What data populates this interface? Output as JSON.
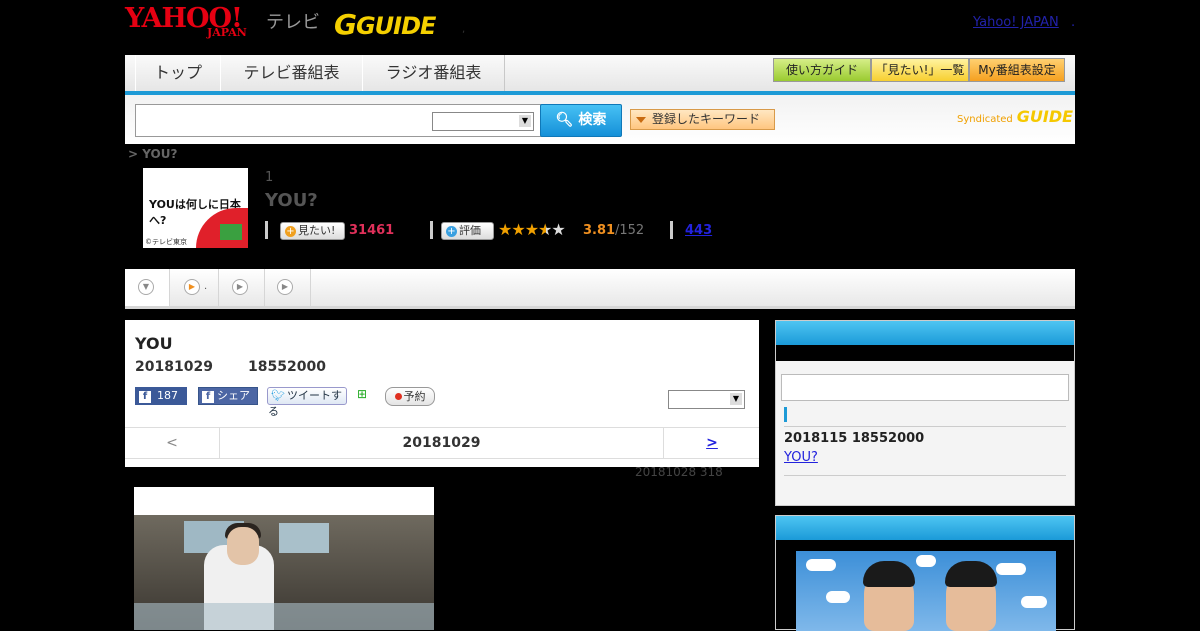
{
  "header": {
    "logo_yahoo": "YAHOO!",
    "logo_japan": "JAPAN",
    "logo_tv": "テレビ",
    "logo_gguide": "GUIDE",
    "dot": ",",
    "yahoo_japan_link": "Yahoo! JAPAN",
    "link_dot": "."
  },
  "nav": {
    "tabs": [
      "トップ",
      "テレビ番組表",
      "ラジオ番組表"
    ],
    "buttons": [
      "使い方ガイド",
      "「見たい!」一覧",
      "My番組表設定"
    ]
  },
  "search": {
    "input_value": "",
    "select_value": "",
    "search_label": "検索",
    "keyword_label": "登録したキーワード",
    "syndicated": "Syndicated",
    "syndicated_logo": "GUIDE"
  },
  "breadcrumb": "> YOU?",
  "program": {
    "number": "1",
    "title": "YOU?",
    "thumb_title": "YOUは何しに日本へ?",
    "thumb_copyright": "©テレビ東京",
    "mitai_label": "見たい!",
    "mitai_count": "31461",
    "rate_label": "評価",
    "rating_stars": 3.81,
    "rating_score": "3.81",
    "rating_votes": "/152",
    "review_link": "443"
  },
  "subtabs": [
    {
      "label": ""
    },
    {
      "label": "."
    },
    {
      "label": ""
    },
    {
      "label": ""
    }
  ],
  "main": {
    "title": "YOU",
    "date": "20181029",
    "time": "18552000",
    "fb_count": "187",
    "fb_share": "シェア",
    "tweet": "ツイートする",
    "yoyaku": "予約",
    "select_value": "",
    "pager_prev": "<",
    "pager_date": "20181029",
    "pager_next": ">",
    "updated": "20181028  318"
  },
  "right": {
    "date_time": "2018115  18552000",
    "link": "YOU?"
  },
  "colors": {
    "accent_blue": "#1d9ad6",
    "mitai_pink": "#e0305a",
    "star_orange": "#f0a000"
  }
}
